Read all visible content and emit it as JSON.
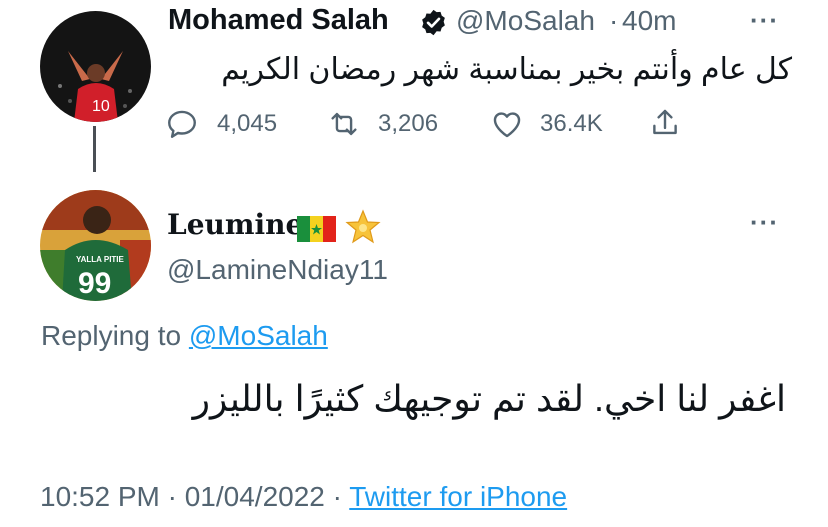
{
  "tweet": {
    "author_name": "Mohamed Salah",
    "author_handle": "@MoSalah",
    "separator": "·",
    "time": "40m",
    "text": "كل عام وأنتم بخير بمناسبة شهر رمضان الكريم",
    "replies": "4,045",
    "retweets": "3,206",
    "likes": "36.4K",
    "more_label": "···"
  },
  "reply": {
    "author_name": "Leumine",
    "author_handle": "@LamineNdiay11",
    "jersey_text": "YALLA PITIE",
    "jersey_number": "99",
    "replying_prefix": "Replying to ",
    "replying_to": "@MoSalah",
    "text": "اغفر لنا اخي. لقد تم توجيهك كثيرًا بالليزر",
    "date_time": "10:52 PM · 01/04/2022 · ",
    "source": "Twitter for iPhone",
    "more_label": "···"
  },
  "avatar1": {
    "shirt_number": "10"
  },
  "colors": {
    "accent": "#1d9bf0",
    "muted": "#536471",
    "text": "#0f1419"
  },
  "icons": [
    "verified-badge-icon",
    "reply-icon",
    "retweet-icon",
    "like-icon",
    "share-icon",
    "more-icon",
    "senegal-flag-icon",
    "star-icon"
  ]
}
